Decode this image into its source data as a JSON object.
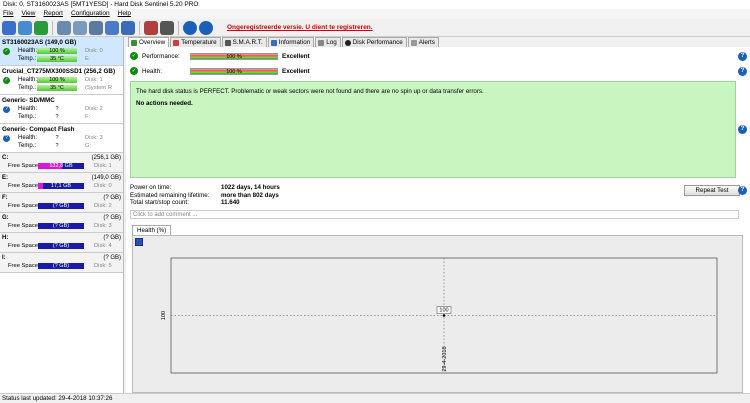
{
  "window": {
    "title": "Disk: 0, ST3160023AS [5MT1YESD]  -  Hard Disk Sentinel 5.20 PRO"
  },
  "menu": [
    "File",
    "View",
    "Report",
    "Configuration",
    "Help"
  ],
  "toolbar": {
    "unregistered_text": "Ongeregistreerde versie. U dient te registreren."
  },
  "disks": [
    {
      "name": "ST3160023AS (149,0 GB)",
      "health_label": "Health:",
      "health": "100 %",
      "disk_ref": "Disk: 0",
      "temp_label": "Temp.:",
      "temp": "35 °C",
      "temp_extra": "E:",
      "status": "ok"
    },
    {
      "name": "Crucial_CT275MX300SSD1 (256,2 GB)",
      "health_label": "Health:",
      "health": "100 %",
      "disk_ref": "Disk: 1",
      "temp_label": "Temp.:",
      "temp": "35 °C",
      "temp_extra": "(System R",
      "status": "ok"
    },
    {
      "name": "Generic- SD/MMC",
      "health_label": "Health:",
      "health": "?",
      "disk_ref": "Disk: 2",
      "temp_label": "Temp.:",
      "temp": "?",
      "temp_extra": "F:",
      "status": "unknown"
    },
    {
      "name": "Generic- Compact Flash",
      "health_label": "Health:",
      "health": "?",
      "disk_ref": "Disk: 3",
      "temp_label": "Temp.:",
      "temp": "?",
      "temp_extra": "G:",
      "status": "unknown"
    }
  ],
  "volumes": [
    {
      "letter": "C:",
      "size": "(256,1 GB)",
      "free_label": "Free Space",
      "free": "132,8 GB",
      "disk_ref": "Disk: 1",
      "fill": 0.52
    },
    {
      "letter": "E:",
      "size": "(149,0 GB)",
      "free_label": "Free Space",
      "free": "17,1 GB",
      "disk_ref": "Disk: 0",
      "fill": 0.11
    },
    {
      "letter": "F:",
      "size": "(? GB)",
      "free_label": "Free Space",
      "free": "(? GB)",
      "disk_ref": "Disk: 2",
      "fill": 0
    },
    {
      "letter": "G:",
      "size": "(? GB)",
      "free_label": "Free Space",
      "free": "(? GB)",
      "disk_ref": "Disk: 3",
      "fill": 0
    },
    {
      "letter": "H:",
      "size": "(? GB)",
      "free_label": "Free Space",
      "free": "(? GB)",
      "disk_ref": "Disk: 4",
      "fill": 0
    },
    {
      "letter": "I:",
      "size": "(? GB)",
      "free_label": "Free Space",
      "free": "(? GB)",
      "disk_ref": "Disk: 5",
      "fill": 0
    }
  ],
  "tabs": [
    "Overview",
    "Temperature",
    "S.M.A.R.T.",
    "Information",
    "Log",
    "Disk Performance",
    "Alerts"
  ],
  "overview": {
    "performance_label": "Performance:",
    "performance_value": "100 %",
    "performance_word": "Excellent",
    "health_label": "Health:",
    "health_value": "100 %",
    "health_word": "Excellent",
    "status_text": "The hard disk status is PERFECT. Problematic or weak sectors were not found and there are no spin up or data transfer errors.",
    "actions_text": "No actions needed.",
    "power_on_label": "Power on time:",
    "power_on_value": "1022 days, 14 hours",
    "lifetime_label": "Estimated remaining lifetime:",
    "lifetime_value": "more than 802 days",
    "startstop_label": "Total start/stop count:",
    "startstop_value": "11.640",
    "repeat_button": "Repeat Test",
    "comment_placeholder": "Click to add comment ..."
  },
  "health_tab": "Health (%)",
  "chart_data": {
    "type": "line",
    "x": [
      "29-4-2018"
    ],
    "series": [
      {
        "values": [
          100
        ]
      }
    ],
    "ylabel": "100",
    "point_label": "100",
    "ylim": [
      0,
      200
    ]
  },
  "status_bar": "Status last updated: 29-4-2018 10:37:26"
}
